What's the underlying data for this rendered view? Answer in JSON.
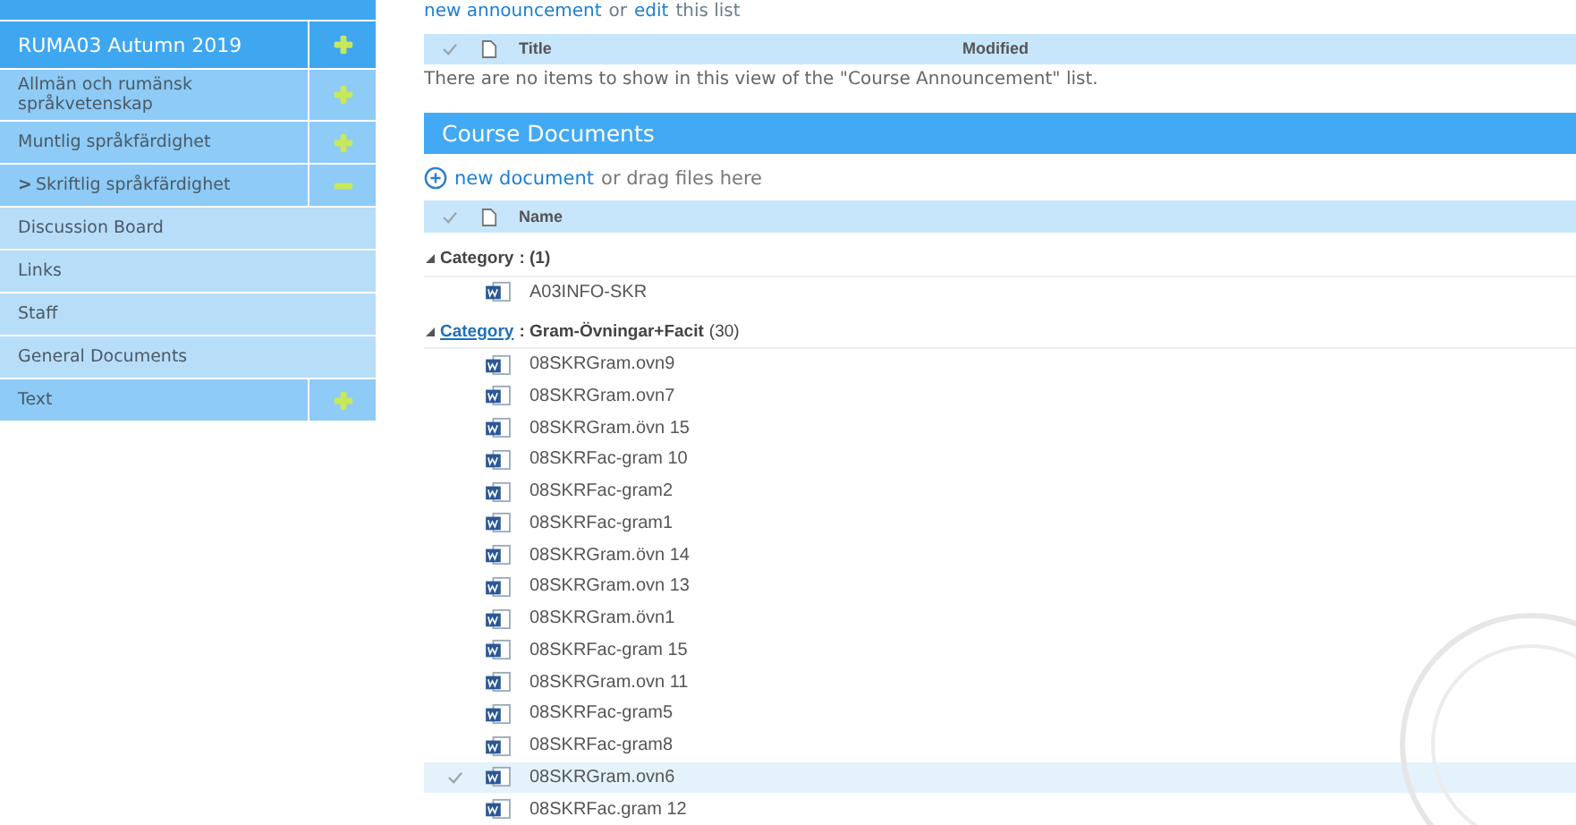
{
  "sidebar": {
    "items": [
      {
        "kind": "course",
        "label": "RUMA03 Autumn 2019",
        "expanded": false
      },
      {
        "kind": "section",
        "label": "Allmän och rumänsk språkvetenskap",
        "expanded": false
      },
      {
        "kind": "section",
        "label": "Muntlig språkfärdighet",
        "expanded": false
      },
      {
        "kind": "section",
        "marker": ">",
        "label": "Skriftlig språkfärdighet",
        "expanded": true
      },
      {
        "kind": "page",
        "label": "Discussion Board"
      },
      {
        "kind": "page",
        "label": "Links"
      },
      {
        "kind": "page",
        "label": "Staff"
      },
      {
        "kind": "page",
        "label": "General Documents"
      },
      {
        "kind": "section",
        "label": "Text",
        "expanded": false
      }
    ]
  },
  "announcements": {
    "new_link": "new announcement",
    "or_text": "or",
    "edit_link": "edit",
    "tail_text": "this list",
    "columns": [
      "Title",
      "Modified"
    ],
    "empty_message": "There are no items to show in this view of the \"Course Announcement\" list."
  },
  "documents": {
    "title": "Course Documents",
    "new_link": "new document",
    "new_tail": "or drag files here",
    "columns": [
      "Name"
    ],
    "groups": [
      {
        "label": "Category",
        "linked": false,
        "value": ": (1)",
        "items": [
          {
            "name": "A03INFO-SKR",
            "selected": false
          }
        ]
      },
      {
        "label": "Category",
        "linked": true,
        "value": ": Gram-Övningar+Facit",
        "count": "(30)",
        "items": [
          {
            "name": "08SKRGram.ovn9",
            "selected": false
          },
          {
            "name": "08SKRGram.ovn7",
            "selected": false
          },
          {
            "name": "08SKRGram.övn 15",
            "selected": false
          },
          {
            "name": "08SKRFac-gram 10",
            "selected": false
          },
          {
            "name": "08SKRFac-gram2",
            "selected": false
          },
          {
            "name": "08SKRFac-gram1",
            "selected": false
          },
          {
            "name": "08SKRGram.övn 14",
            "selected": false
          },
          {
            "name": "08SKRGram.ovn 13",
            "selected": false
          },
          {
            "name": "08SKRGram.övn1",
            "selected": false
          },
          {
            "name": "08SKRFac-gram 15",
            "selected": false
          },
          {
            "name": "08SKRGram.ovn 11",
            "selected": false
          },
          {
            "name": "08SKRFac-gram5",
            "selected": false
          },
          {
            "name": "08SKRFac-gram8",
            "selected": false
          },
          {
            "name": "08SKRGram.ovn6",
            "selected": true
          },
          {
            "name": "08SKRFac.gram 12",
            "selected": false
          }
        ]
      }
    ]
  }
}
